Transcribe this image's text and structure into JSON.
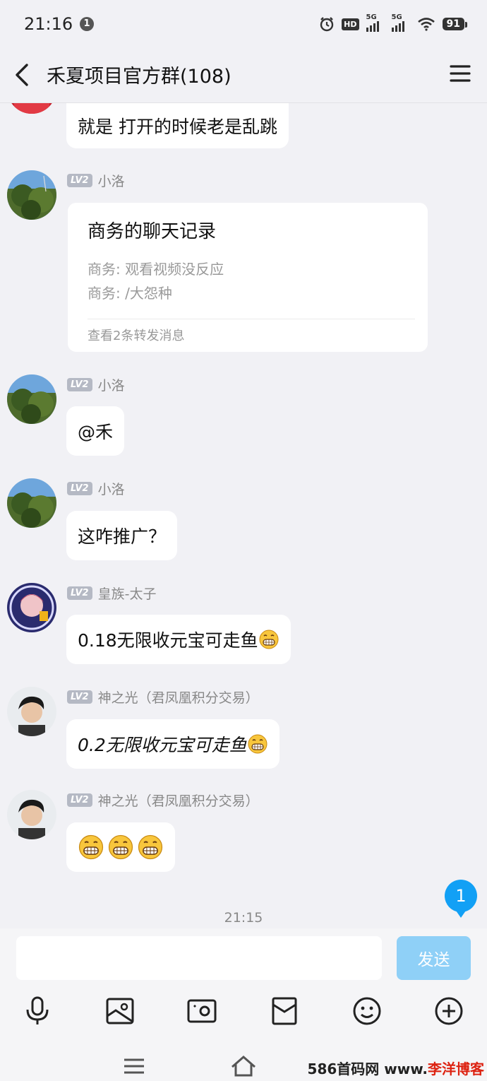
{
  "status_bar": {
    "time": "21:16",
    "notification_count": "1",
    "hd_label": "HD",
    "network_1": "5G",
    "network_2": "5G",
    "battery": "91"
  },
  "header": {
    "title": "禾夏项目官方群(108)"
  },
  "messages": [
    {
      "text": "就是  打开的时候老是乱跳"
    },
    {
      "level": "LV2",
      "sender": "小洛",
      "forward": {
        "title": "商务的聊天记录",
        "lines": [
          "商务: 观看视频没反应",
          "商务: /大怨种"
        ],
        "footer": "查看2条转发消息"
      }
    },
    {
      "level": "LV2",
      "sender": "小洛",
      "text": "@禾"
    },
    {
      "level": "LV2",
      "sender": "小洛",
      "text": "这咋推广？"
    },
    {
      "level": "LV2",
      "sender": "皇族-太子",
      "text": "0.18无限收元宝可走鱼"
    },
    {
      "level": "LV2",
      "sender": "神之光（君凤凰积分交易）",
      "text": "0.2无限收元宝可走鱼"
    },
    {
      "level": "LV2",
      "sender": "神之光（君凤凰积分交易）"
    }
  ],
  "time_divider": "21:15",
  "unread_count": "1",
  "input": {
    "placeholder": "",
    "value": "",
    "send_label": "发送"
  },
  "toolbar_icons": [
    "microphone-icon",
    "photo-icon",
    "camera-icon",
    "red-packet-icon",
    "emoji-icon",
    "plus-icon"
  ],
  "watermark": {
    "part1": "586首码网",
    "part2": " www.",
    "part3": "李洋博客"
  },
  "colors": {
    "background": "#f1f1f5",
    "accent": "#12a0f5",
    "send_disabled": "#8fd0f7",
    "level_badge": "#b5b9c4"
  }
}
